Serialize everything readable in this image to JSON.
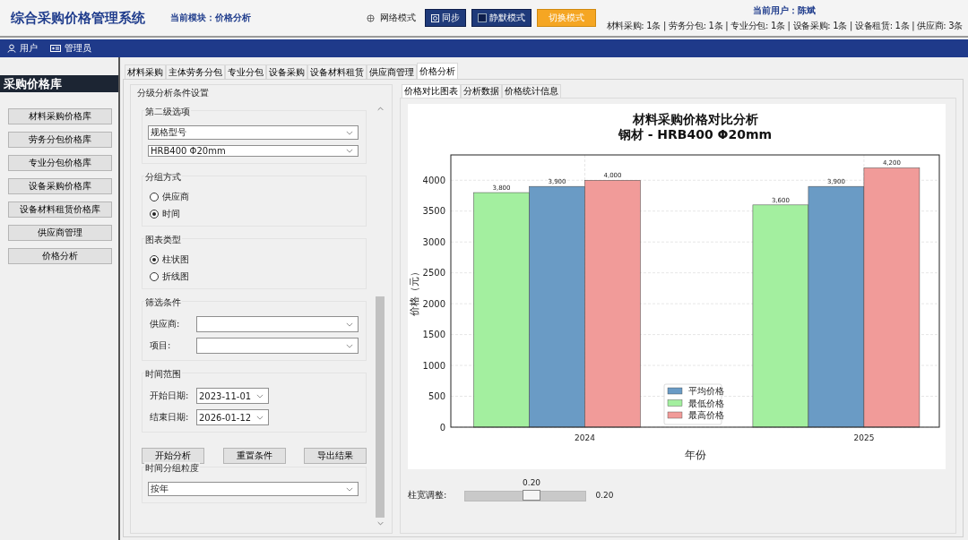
{
  "header": {
    "title": "综合采购价格管理系统",
    "module": "当前模块：价格分析",
    "network": "网络模式",
    "sync": "同步",
    "silent": {
      "label": "静默模式",
      "checked": false
    },
    "switch": "切换模式",
    "user": "当前用户：陈斌",
    "counts": "材料采购: 1条 | 劳务分包: 1条 | 专业分包: 1条 | 设备采购: 1条 | 设备租赁: 1条 | 供应商: 3条"
  },
  "user_bar": [
    {
      "kind": "user",
      "label": "用户"
    },
    {
      "kind": "card",
      "label": "管理员"
    }
  ],
  "sidebar": {
    "title": "采购价格库",
    "items": [
      "材料采购价格库",
      "劳务分包价格库",
      "专业分包价格库",
      "设备采购价格库",
      "设备材料租赁价格库",
      "供应商管理",
      "价格分析"
    ]
  },
  "tabs": [
    {
      "label": "材料采购",
      "selected": false
    },
    {
      "label": "主体劳务分包",
      "selected": false
    },
    {
      "label": "专业分包",
      "selected": false
    },
    {
      "label": "设备采购",
      "selected": false
    },
    {
      "label": "设备材料租赁",
      "selected": false
    },
    {
      "label": "供应商管理",
      "selected": false
    },
    {
      "label": "价格分析",
      "selected": true
    }
  ],
  "settings": {
    "title": "分级分析条件设置",
    "sections": [
      {
        "kind": "select_group",
        "title": "第二级选项",
        "selects": [
          "规格型号",
          "HRB400 Φ20mm"
        ]
      },
      {
        "kind": "radio_group",
        "title": "分组方式",
        "options": [
          {
            "label": "供应商",
            "selected": false
          },
          {
            "label": "时间",
            "selected": true
          }
        ]
      },
      {
        "kind": "radio_group",
        "title": "图表类型",
        "options": [
          {
            "label": "柱状图",
            "selected": true
          },
          {
            "label": "折线图",
            "selected": false
          }
        ]
      },
      {
        "kind": "field_group",
        "title": "筛选条件",
        "fields": [
          {
            "label": "供应商:"
          },
          {
            "label": "项目:"
          }
        ]
      },
      {
        "kind": "date_group",
        "title": "时间范围",
        "fields": [
          {
            "label": "开始日期:",
            "value": "2023-11-01"
          },
          {
            "label": "结束日期:",
            "value": "2026-01-12"
          }
        ]
      },
      {
        "kind": "buttons",
        "buttons": [
          "开始分析",
          "重置条件",
          "导出结果"
        ]
      },
      {
        "kind": "select_group",
        "title": "时间分组粒度",
        "selects": [
          "按年"
        ]
      }
    ]
  },
  "result_tabs": [
    {
      "label": "价格对比图表",
      "selected": true
    },
    {
      "label": "分析数据",
      "selected": false
    },
    {
      "label": "价格统计信息",
      "selected": false
    }
  ],
  "chart_data": {
    "type": "bar",
    "title": "材料采购价格对比分析",
    "subtitle": "钢材 - HRB400 Φ20mm",
    "xlabel": "年份",
    "ylabel": "价格（元）",
    "categories": [
      "2024",
      "2025"
    ],
    "series": [
      {
        "name": "平均价格",
        "color": "#6a9bc5",
        "values": [
          3900,
          3900
        ]
      },
      {
        "name": "最低价格",
        "color": "#a3ef9f",
        "values": [
          3800,
          3600
        ]
      },
      {
        "name": "最高价格",
        "color": "#f19b99",
        "values": [
          4000,
          4200
        ]
      }
    ],
    "ylim": [
      0,
      4410
    ],
    "yticks": [
      0,
      500,
      1000,
      1500,
      2000,
      2500,
      3000,
      3500,
      4000
    ],
    "grid": true,
    "legend": true,
    "value_labels": [
      [
        "3,900",
        "3,900"
      ],
      [
        "3,800",
        "3,600"
      ],
      [
        "4,000",
        "4,200"
      ]
    ]
  },
  "slider": {
    "label": "柱宽调整:",
    "value_label": "0.20",
    "level": 0.55,
    "reading": "0.20"
  }
}
